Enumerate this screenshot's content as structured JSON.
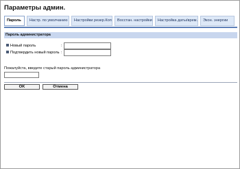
{
  "header": {
    "title": "Параметры админ."
  },
  "tabs": [
    {
      "label": "Пароль",
      "active": true
    },
    {
      "label": "Настр. по умолчанию",
      "active": false
    },
    {
      "label": "Настройки резер.Коп",
      "active": false
    },
    {
      "label": "Восстан. настройки",
      "active": false
    },
    {
      "label": "Настройка даты/врем.",
      "active": false
    },
    {
      "label": "Экон. энергии",
      "active": false
    }
  ],
  "section": {
    "title": "Пароль администратора",
    "fields": [
      {
        "label": "Новый пароль",
        "colon": ":",
        "value": ""
      },
      {
        "label": "Подтвердить новый пароль",
        "colon": ":",
        "value": ""
      }
    ]
  },
  "old_password": {
    "prompt": "Пожалуйста, введите старый пароль администратора",
    "value": ""
  },
  "buttons": {
    "ok_label": "OK",
    "cancel_label": "Отмена"
  },
  "colors": {
    "tab_bg": "#dde8f7",
    "tab_active_bg": "#ffffff",
    "tab_underline": "#5c7fb8",
    "section_header_bg": "#c8d6ee"
  }
}
